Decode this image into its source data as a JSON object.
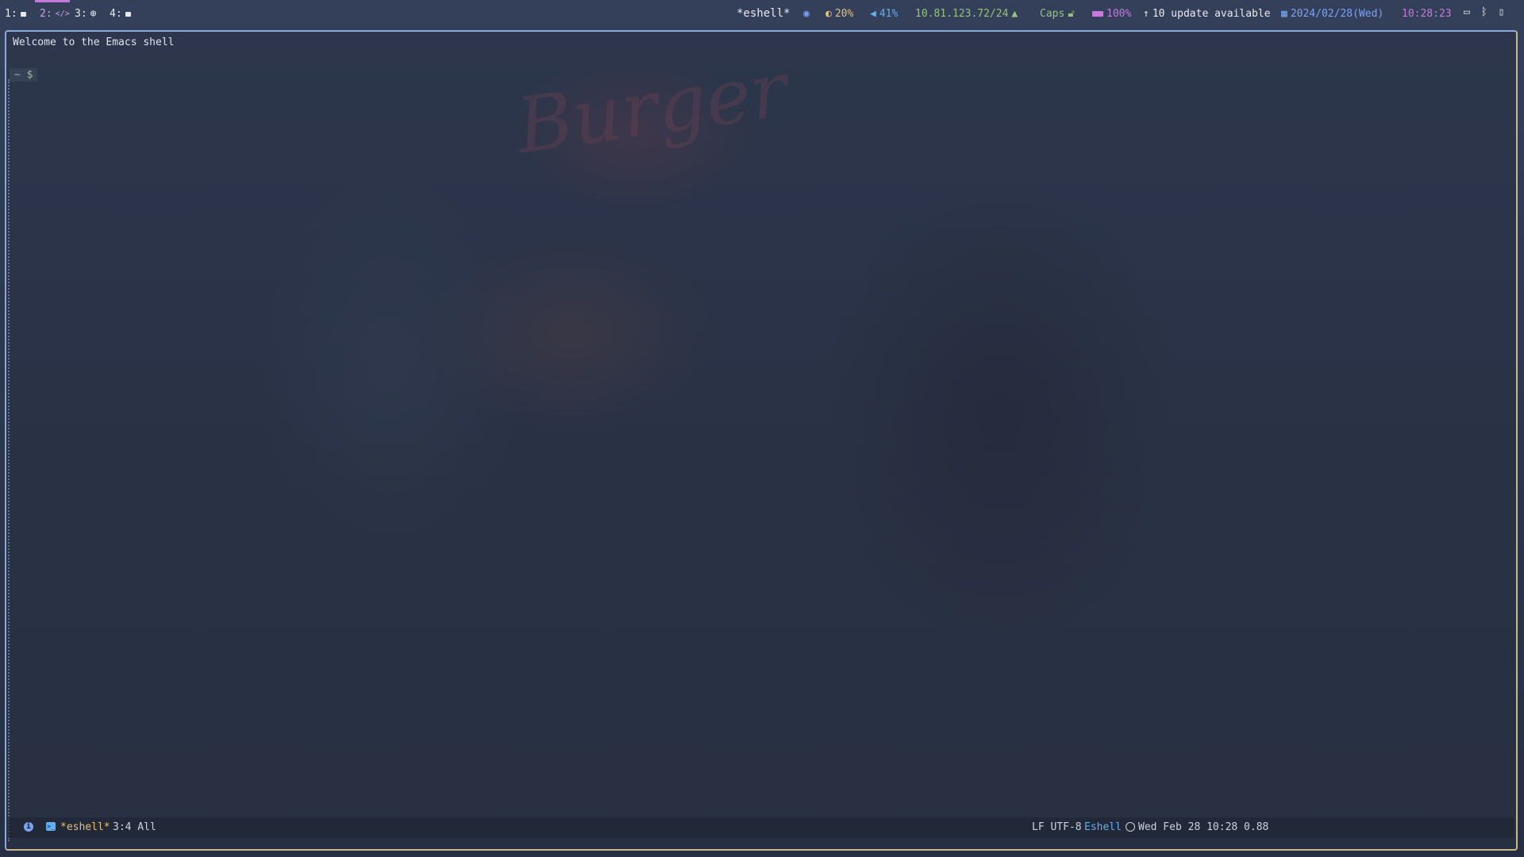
{
  "topbar": {
    "workspaces": [
      {
        "label": "1:",
        "icon": "window-icon"
      },
      {
        "label": "2:",
        "icon": "code-icon"
      },
      {
        "label": "3:",
        "icon": "globe-icon"
      },
      {
        "label": "4:",
        "icon": "window-icon"
      }
    ],
    "active_workspace": "2:",
    "window_title": "*eshell*",
    "brightness": "20%",
    "volume": "41%",
    "network": "10.81.123.72/24",
    "caps": "Caps",
    "battery": "100%",
    "updates": "10 update available",
    "date": "2024/02/28(Wed)",
    "time": "10:28:23"
  },
  "emacs": {
    "welcome": "Welcome to the Emacs shell",
    "prompt_dir": "~",
    "prompt_symbol": "$"
  },
  "modeline": {
    "buffer": "*eshell*",
    "position": "3:4 All",
    "encoding": "LF UTF-8",
    "major_mode": "Eshell",
    "datetime": "Wed Feb 28 10:28 0.88"
  },
  "colors": {
    "accent": "#c678dd",
    "buffer_name": "#e5c07b",
    "mode_name": "#61afef"
  }
}
